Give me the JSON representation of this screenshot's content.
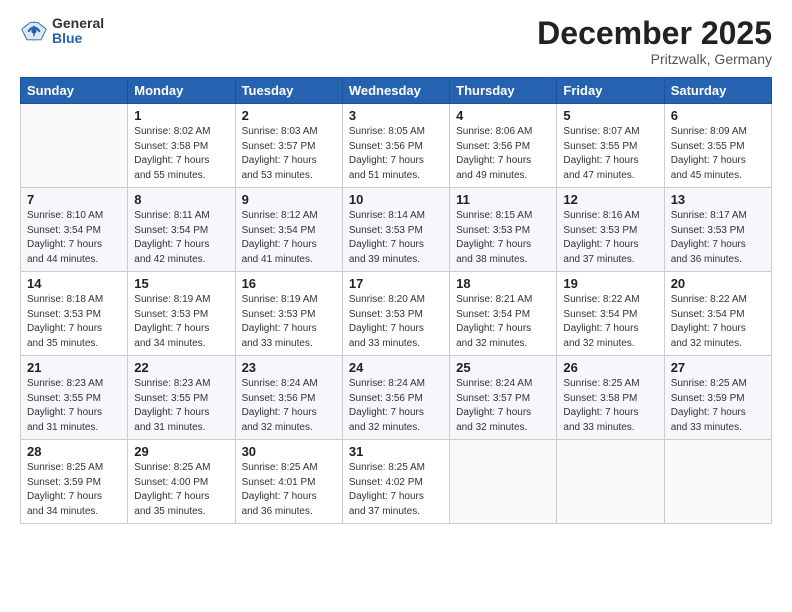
{
  "logo": {
    "general": "General",
    "blue": "Blue"
  },
  "header": {
    "month": "December 2025",
    "location": "Pritzwalk, Germany"
  },
  "weekdays": [
    "Sunday",
    "Monday",
    "Tuesday",
    "Wednesday",
    "Thursday",
    "Friday",
    "Saturday"
  ],
  "weeks": [
    [
      {
        "day": "",
        "sunrise": "",
        "sunset": "",
        "daylight": ""
      },
      {
        "day": "1",
        "sunrise": "Sunrise: 8:02 AM",
        "sunset": "Sunset: 3:58 PM",
        "daylight": "Daylight: 7 hours",
        "daylight2": "and 55 minutes."
      },
      {
        "day": "2",
        "sunrise": "Sunrise: 8:03 AM",
        "sunset": "Sunset: 3:57 PM",
        "daylight": "Daylight: 7 hours",
        "daylight2": "and 53 minutes."
      },
      {
        "day": "3",
        "sunrise": "Sunrise: 8:05 AM",
        "sunset": "Sunset: 3:56 PM",
        "daylight": "Daylight: 7 hours",
        "daylight2": "and 51 minutes."
      },
      {
        "day": "4",
        "sunrise": "Sunrise: 8:06 AM",
        "sunset": "Sunset: 3:56 PM",
        "daylight": "Daylight: 7 hours",
        "daylight2": "and 49 minutes."
      },
      {
        "day": "5",
        "sunrise": "Sunrise: 8:07 AM",
        "sunset": "Sunset: 3:55 PM",
        "daylight": "Daylight: 7 hours",
        "daylight2": "and 47 minutes."
      },
      {
        "day": "6",
        "sunrise": "Sunrise: 8:09 AM",
        "sunset": "Sunset: 3:55 PM",
        "daylight": "Daylight: 7 hours",
        "daylight2": "and 45 minutes."
      }
    ],
    [
      {
        "day": "7",
        "sunrise": "Sunrise: 8:10 AM",
        "sunset": "Sunset: 3:54 PM",
        "daylight": "Daylight: 7 hours",
        "daylight2": "and 44 minutes."
      },
      {
        "day": "8",
        "sunrise": "Sunrise: 8:11 AM",
        "sunset": "Sunset: 3:54 PM",
        "daylight": "Daylight: 7 hours",
        "daylight2": "and 42 minutes."
      },
      {
        "day": "9",
        "sunrise": "Sunrise: 8:12 AM",
        "sunset": "Sunset: 3:54 PM",
        "daylight": "Daylight: 7 hours",
        "daylight2": "and 41 minutes."
      },
      {
        "day": "10",
        "sunrise": "Sunrise: 8:14 AM",
        "sunset": "Sunset: 3:53 PM",
        "daylight": "Daylight: 7 hours",
        "daylight2": "and 39 minutes."
      },
      {
        "day": "11",
        "sunrise": "Sunrise: 8:15 AM",
        "sunset": "Sunset: 3:53 PM",
        "daylight": "Daylight: 7 hours",
        "daylight2": "and 38 minutes."
      },
      {
        "day": "12",
        "sunrise": "Sunrise: 8:16 AM",
        "sunset": "Sunset: 3:53 PM",
        "daylight": "Daylight: 7 hours",
        "daylight2": "and 37 minutes."
      },
      {
        "day": "13",
        "sunrise": "Sunrise: 8:17 AM",
        "sunset": "Sunset: 3:53 PM",
        "daylight": "Daylight: 7 hours",
        "daylight2": "and 36 minutes."
      }
    ],
    [
      {
        "day": "14",
        "sunrise": "Sunrise: 8:18 AM",
        "sunset": "Sunset: 3:53 PM",
        "daylight": "Daylight: 7 hours",
        "daylight2": "and 35 minutes."
      },
      {
        "day": "15",
        "sunrise": "Sunrise: 8:19 AM",
        "sunset": "Sunset: 3:53 PM",
        "daylight": "Daylight: 7 hours",
        "daylight2": "and 34 minutes."
      },
      {
        "day": "16",
        "sunrise": "Sunrise: 8:19 AM",
        "sunset": "Sunset: 3:53 PM",
        "daylight": "Daylight: 7 hours",
        "daylight2": "and 33 minutes."
      },
      {
        "day": "17",
        "sunrise": "Sunrise: 8:20 AM",
        "sunset": "Sunset: 3:53 PM",
        "daylight": "Daylight: 7 hours",
        "daylight2": "and 33 minutes."
      },
      {
        "day": "18",
        "sunrise": "Sunrise: 8:21 AM",
        "sunset": "Sunset: 3:54 PM",
        "daylight": "Daylight: 7 hours",
        "daylight2": "and 32 minutes."
      },
      {
        "day": "19",
        "sunrise": "Sunrise: 8:22 AM",
        "sunset": "Sunset: 3:54 PM",
        "daylight": "Daylight: 7 hours",
        "daylight2": "and 32 minutes."
      },
      {
        "day": "20",
        "sunrise": "Sunrise: 8:22 AM",
        "sunset": "Sunset: 3:54 PM",
        "daylight": "Daylight: 7 hours",
        "daylight2": "and 32 minutes."
      }
    ],
    [
      {
        "day": "21",
        "sunrise": "Sunrise: 8:23 AM",
        "sunset": "Sunset: 3:55 PM",
        "daylight": "Daylight: 7 hours",
        "daylight2": "and 31 minutes."
      },
      {
        "day": "22",
        "sunrise": "Sunrise: 8:23 AM",
        "sunset": "Sunset: 3:55 PM",
        "daylight": "Daylight: 7 hours",
        "daylight2": "and 31 minutes."
      },
      {
        "day": "23",
        "sunrise": "Sunrise: 8:24 AM",
        "sunset": "Sunset: 3:56 PM",
        "daylight": "Daylight: 7 hours",
        "daylight2": "and 32 minutes."
      },
      {
        "day": "24",
        "sunrise": "Sunrise: 8:24 AM",
        "sunset": "Sunset: 3:56 PM",
        "daylight": "Daylight: 7 hours",
        "daylight2": "and 32 minutes."
      },
      {
        "day": "25",
        "sunrise": "Sunrise: 8:24 AM",
        "sunset": "Sunset: 3:57 PM",
        "daylight": "Daylight: 7 hours",
        "daylight2": "and 32 minutes."
      },
      {
        "day": "26",
        "sunrise": "Sunrise: 8:25 AM",
        "sunset": "Sunset: 3:58 PM",
        "daylight": "Daylight: 7 hours",
        "daylight2": "and 33 minutes."
      },
      {
        "day": "27",
        "sunrise": "Sunrise: 8:25 AM",
        "sunset": "Sunset: 3:59 PM",
        "daylight": "Daylight: 7 hours",
        "daylight2": "and 33 minutes."
      }
    ],
    [
      {
        "day": "28",
        "sunrise": "Sunrise: 8:25 AM",
        "sunset": "Sunset: 3:59 PM",
        "daylight": "Daylight: 7 hours",
        "daylight2": "and 34 minutes."
      },
      {
        "day": "29",
        "sunrise": "Sunrise: 8:25 AM",
        "sunset": "Sunset: 4:00 PM",
        "daylight": "Daylight: 7 hours",
        "daylight2": "and 35 minutes."
      },
      {
        "day": "30",
        "sunrise": "Sunrise: 8:25 AM",
        "sunset": "Sunset: 4:01 PM",
        "daylight": "Daylight: 7 hours",
        "daylight2": "and 36 minutes."
      },
      {
        "day": "31",
        "sunrise": "Sunrise: 8:25 AM",
        "sunset": "Sunset: 4:02 PM",
        "daylight": "Daylight: 7 hours",
        "daylight2": "and 37 minutes."
      },
      {
        "day": "",
        "sunrise": "",
        "sunset": "",
        "daylight": ""
      },
      {
        "day": "",
        "sunrise": "",
        "sunset": "",
        "daylight": ""
      },
      {
        "day": "",
        "sunrise": "",
        "sunset": "",
        "daylight": ""
      }
    ]
  ]
}
